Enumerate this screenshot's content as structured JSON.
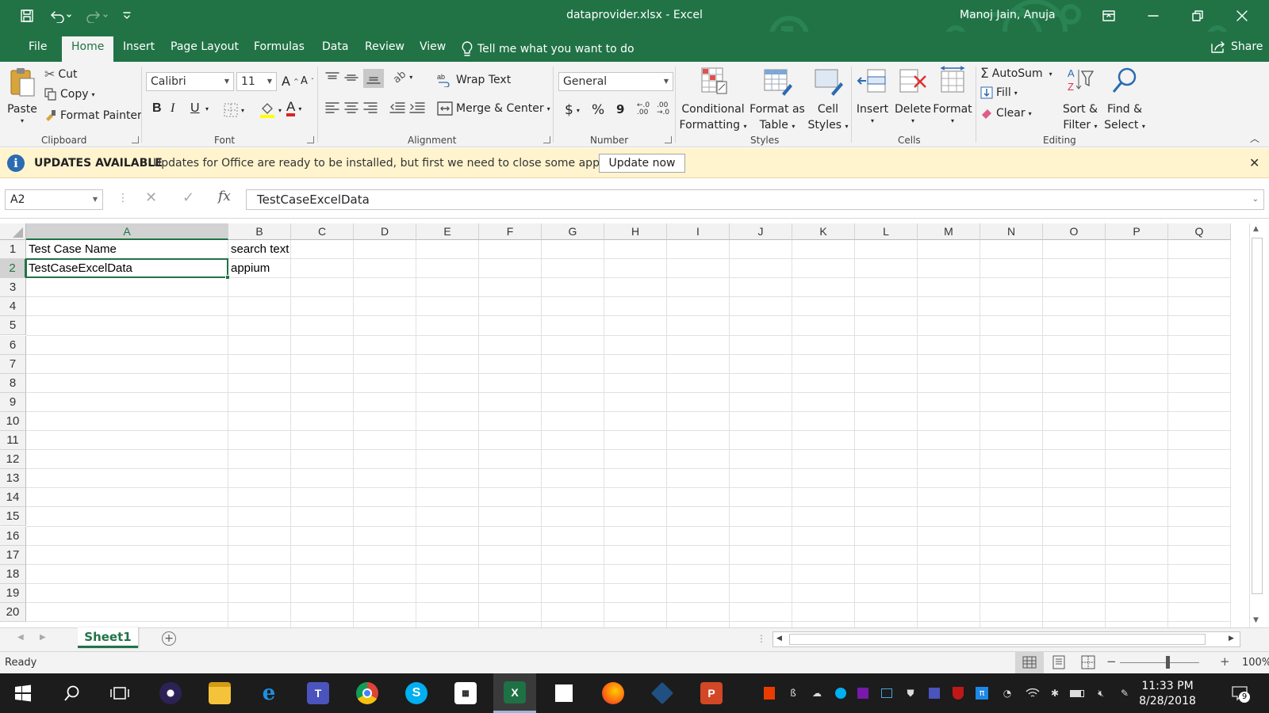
{
  "window": {
    "doc_title": "dataprovider.xlsx  -  Excel",
    "user": "Manoj Jain, Anuja"
  },
  "tabs": [
    "File",
    "Home",
    "Insert",
    "Page Layout",
    "Formulas",
    "Data",
    "Review",
    "View"
  ],
  "active_tab": "Home",
  "tell_me": "Tell me what you want to do",
  "share": "Share",
  "ribbon": {
    "clipboard": {
      "paste": "Paste",
      "cut": "Cut",
      "copy": "Copy",
      "format_painter": "Format Painter",
      "label": "Clipboard"
    },
    "font": {
      "name": "Calibri",
      "size": "11",
      "bold": "B",
      "italic": "I",
      "underline": "U",
      "label": "Font"
    },
    "alignment": {
      "wrap_text": "Wrap Text",
      "merge_center": "Merge & Center",
      "label": "Alignment"
    },
    "number": {
      "format": "General",
      "currency": "$",
      "percent": "%",
      "comma": "9",
      "inc_decimal": "←.0\n.00",
      "dec_decimal": ".00\n→.0",
      "label": "Number"
    },
    "styles": {
      "conditional_1": "Conditional",
      "conditional_2": "Formatting",
      "format_table_1": "Format as",
      "format_table_2": "Table",
      "cell_styles_1": "Cell",
      "cell_styles_2": "Styles",
      "label": "Styles"
    },
    "cells": {
      "insert": "Insert",
      "delete": "Delete",
      "format": "Format",
      "label": "Cells"
    },
    "editing": {
      "autosum": "AutoSum",
      "fill": "Fill",
      "clear": "Clear",
      "sort_1": "Sort &",
      "sort_2": "Filter",
      "find_1": "Find &",
      "find_2": "Select",
      "label": "Editing"
    }
  },
  "infobar": {
    "title": "UPDATES AVAILABLE",
    "message": "Updates for Office are ready to be installed, but first we need to close some apps.",
    "button": "Update now"
  },
  "formula_bar": {
    "name_box": "A2",
    "value": "TestCaseExcelData"
  },
  "sheet": {
    "columns": [
      "A",
      "B",
      "C",
      "D",
      "E",
      "F",
      "G",
      "H",
      "I",
      "J",
      "K",
      "L",
      "M",
      "N",
      "O",
      "P",
      "Q"
    ],
    "rows": [
      "1",
      "2",
      "3",
      "4",
      "5",
      "6",
      "7",
      "8",
      "9",
      "10",
      "11",
      "12",
      "13",
      "14",
      "15",
      "16",
      "17",
      "18",
      "19",
      "20"
    ],
    "selected_cell": "A2",
    "cells": {
      "A1": "Test Case Name",
      "B1": "search text",
      "A2": "TestCaseExcelData",
      "B2": "appium"
    },
    "tabs": [
      "Sheet1"
    ]
  },
  "status": {
    "text": "Ready",
    "zoom": "100%"
  },
  "taskbar": {
    "apps": [
      "start-icon",
      "search-icon",
      "task-view-icon",
      "eclipse-icon",
      "file-explorer-icon",
      "edge-icon",
      "teams-icon",
      "chrome-icon",
      "skype-icon",
      "store-icon",
      "excel-icon",
      "sticky-notes-icon",
      "firefox-icon",
      "sourcetree-icon",
      "powerpoint-icon"
    ],
    "time": "11:33 PM",
    "date": "8/28/2018",
    "notification_count": "9"
  },
  "colors": {
    "excel_green": "#217346",
    "infobar_bg": "#fff4ce",
    "taskbar_bg": "#1c1c1c"
  }
}
